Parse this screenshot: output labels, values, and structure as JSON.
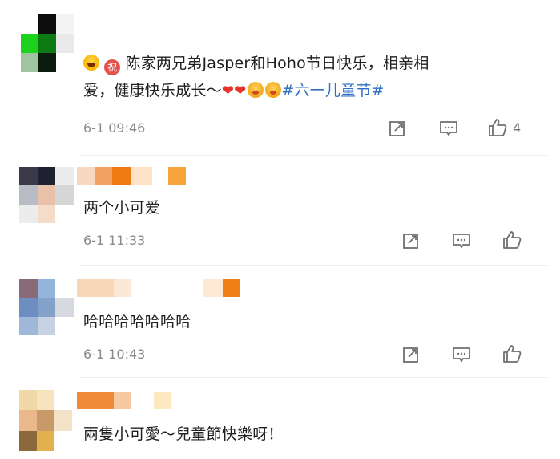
{
  "comments": [
    {
      "text_prefix": "陈家两兄弟Jasper和Hoho节日快乐，相亲相",
      "text_line2": "爱，健康快乐成长～",
      "hashtag": "#六一儿童节#",
      "zhu_emoji_label": "祝",
      "time": "6-1 09:46",
      "like_count": "4"
    },
    {
      "text": "两个小可爱",
      "time": "6-1 11:33",
      "like_count": ""
    },
    {
      "text": "哈哈哈哈哈哈哈",
      "time": "6-1 10:43",
      "like_count": ""
    },
    {
      "text": "兩隻小可愛～兒童節快樂呀！",
      "time": "",
      "like_count": ""
    }
  ],
  "icons": {
    "share": "share-icon",
    "comment": "comment-icon",
    "like": "like-icon"
  },
  "colors": {
    "hashtag": "#2f6fc4",
    "heart": "#e8332b",
    "meta": "#8a8a8a"
  }
}
